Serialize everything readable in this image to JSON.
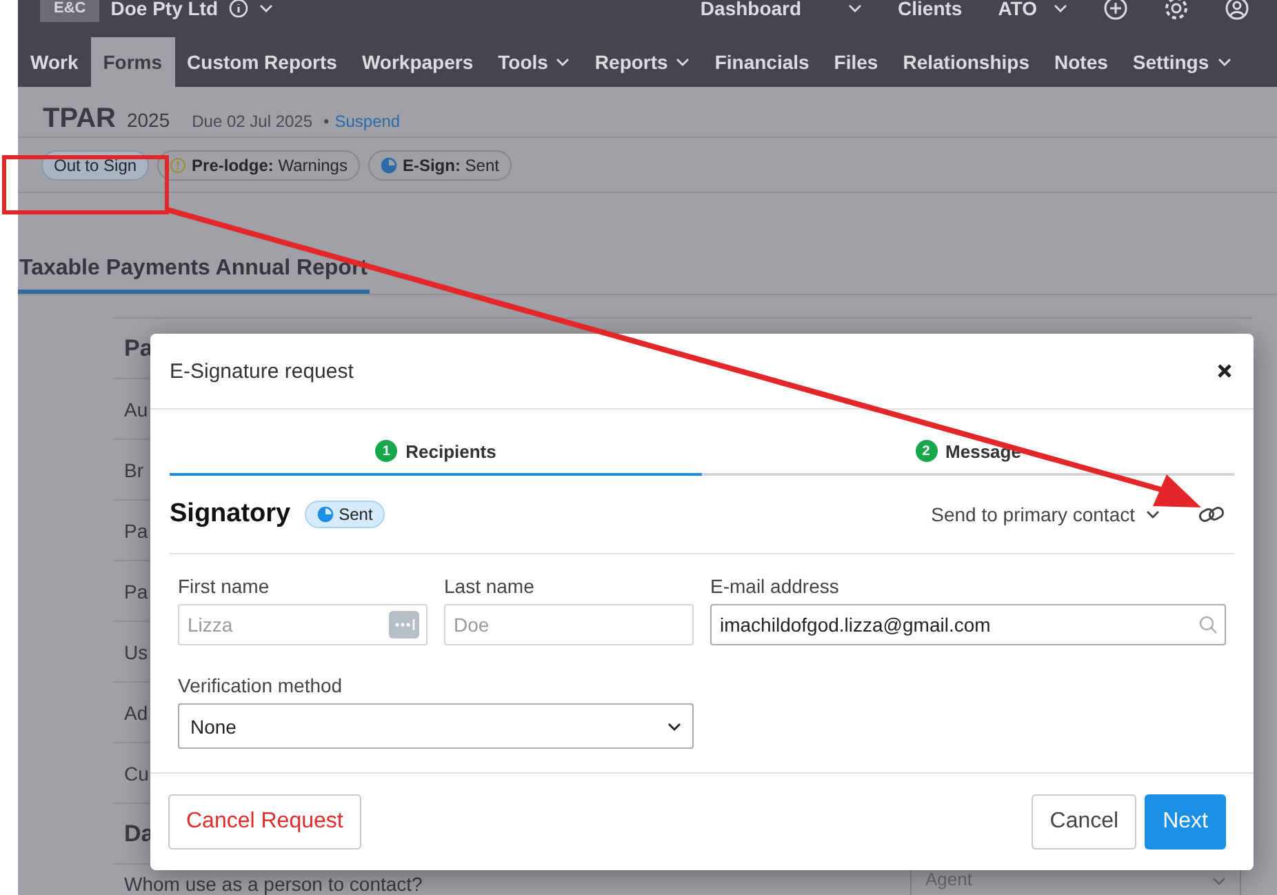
{
  "top_bar": {
    "org_badge": "E&C",
    "org_name": "Doe Pty Ltd",
    "links": [
      {
        "label": "Dashboard",
        "kind": "menu"
      },
      {
        "label": "Clients",
        "kind": "link"
      },
      {
        "label": "ATO",
        "kind": "menu"
      }
    ]
  },
  "nav_tabs": [
    {
      "label": "Work",
      "selected": false,
      "dropdown": false
    },
    {
      "label": "Forms",
      "selected": true,
      "dropdown": false
    },
    {
      "label": "Custom Reports",
      "selected": false,
      "dropdown": false
    },
    {
      "label": "Workpapers",
      "selected": false,
      "dropdown": false
    },
    {
      "label": "Tools",
      "selected": false,
      "dropdown": true
    },
    {
      "label": "Reports",
      "selected": false,
      "dropdown": true
    },
    {
      "label": "Financials",
      "selected": false,
      "dropdown": false
    },
    {
      "label": "Files",
      "selected": false,
      "dropdown": false
    },
    {
      "label": "Relationships",
      "selected": false,
      "dropdown": false
    },
    {
      "label": "Notes",
      "selected": false,
      "dropdown": false
    },
    {
      "label": "Settings",
      "selected": false,
      "dropdown": true
    }
  ],
  "record": {
    "title": "TPAR",
    "year": "2025",
    "due": "Due 02 Jul 2025",
    "separator": "•",
    "link": "Suspend"
  },
  "badges": [
    {
      "kind": "status",
      "label": "Out to Sign"
    },
    {
      "kind": "warning",
      "label": "**Pre-lodge:** Warnings"
    },
    {
      "kind": "progress",
      "label": "**E-Sign:** Sent"
    }
  ],
  "form_tabs": [
    {
      "label": "Taxable Payments Annual Report",
      "selected": true
    }
  ],
  "form_rows": [
    {
      "kind": "heading",
      "label": "Pa"
    },
    {
      "kind": "row",
      "label": "Au"
    },
    {
      "kind": "row",
      "label": "Br"
    },
    {
      "kind": "row",
      "label": "Pa"
    },
    {
      "kind": "row",
      "label": "Pa"
    },
    {
      "kind": "row",
      "label": "Us"
    },
    {
      "kind": "row",
      "label": "Ad"
    },
    {
      "kind": "row",
      "label": "Cu"
    },
    {
      "kind": "heading",
      "label": "Da"
    },
    {
      "kind": "row",
      "label": "Whom use as a person to contact?",
      "select": "Agent"
    }
  ],
  "modal": {
    "title": "E-Signature request",
    "steps": [
      {
        "number": "1",
        "label": "Recipients",
        "selected": true
      },
      {
        "number": "2",
        "label": "Message",
        "selected": false
      }
    ],
    "signatory": {
      "title": "Signatory",
      "status": "Sent",
      "send_option": "Send to primary contact"
    },
    "first_name": {
      "label": "First name",
      "placeholder": "Lizza"
    },
    "last_name": {
      "label": "Last name",
      "placeholder": "Doe"
    },
    "email": {
      "label": "E-mail address",
      "value": "imachildofgod.lizza@gmail.com"
    },
    "verification": {
      "label": "Verification method",
      "value": "None"
    },
    "buttons": {
      "cancel_request": "Cancel Request",
      "cancel": "Cancel",
      "next": "Next"
    }
  }
}
